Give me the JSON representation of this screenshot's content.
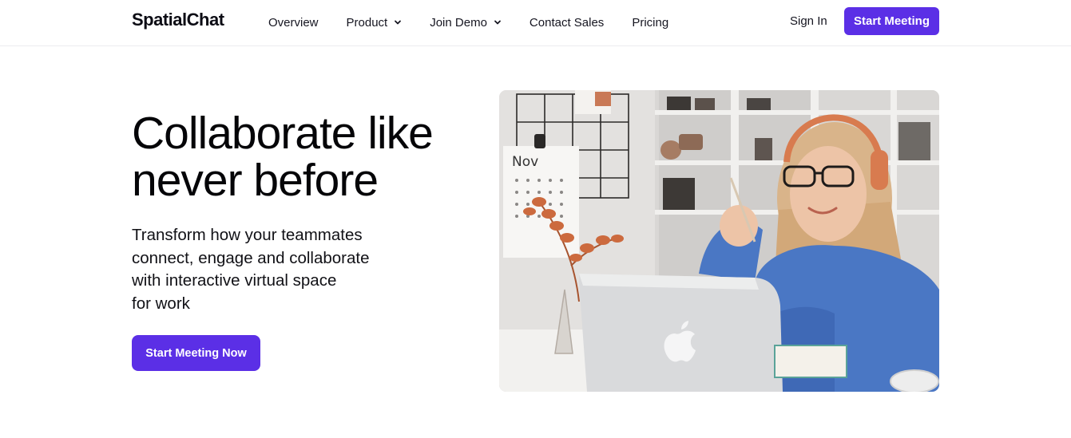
{
  "brand": {
    "name": "SpatialChat",
    "accent": "#5b2fe6"
  },
  "nav": {
    "items": [
      {
        "label": "Overview",
        "has_dropdown": false
      },
      {
        "label": "Product",
        "has_dropdown": true
      },
      {
        "label": "Join Demo",
        "has_dropdown": true
      },
      {
        "label": "Contact Sales",
        "has_dropdown": false
      },
      {
        "label": "Pricing",
        "has_dropdown": false
      }
    ],
    "sign_in": "Sign In",
    "start_meeting": "Start Meeting"
  },
  "hero": {
    "headline_line1": "Collaborate like",
    "headline_line2": "never before",
    "subtitle_lines": [
      "Transform how your teammates",
      "connect, engage and collaborate",
      "with interactive virtual space",
      "for work"
    ],
    "cta": "Start Meeting Now",
    "image": {
      "calendar_month": "Nov",
      "icons": [
        "calendar-icon",
        "apple-logo-icon",
        "headphones-icon"
      ]
    }
  }
}
